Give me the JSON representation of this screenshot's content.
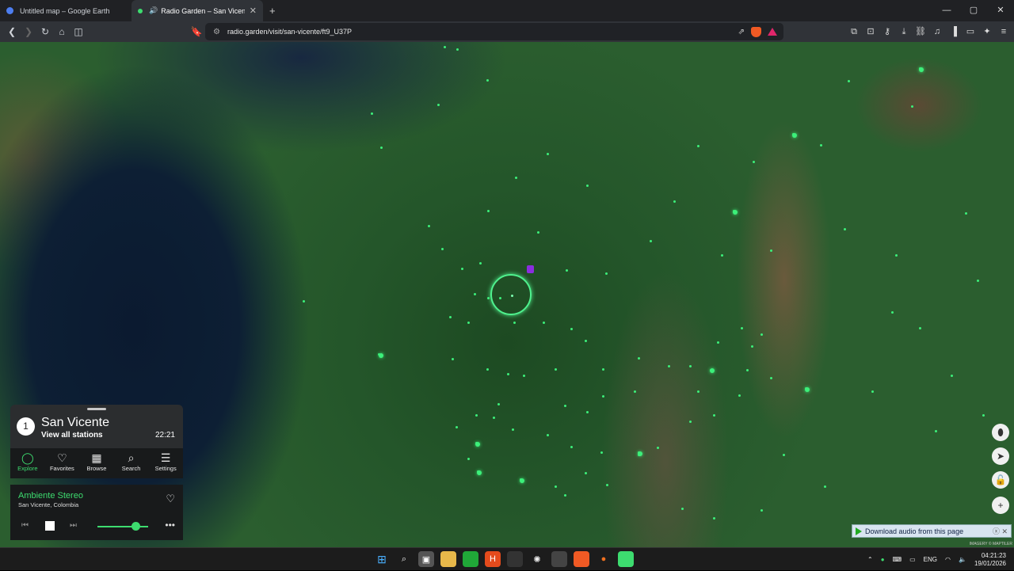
{
  "browser": {
    "tabs": [
      {
        "title": "Untitled map – Google Earth",
        "active": false,
        "icon": "google-earth-icon"
      },
      {
        "title": "Radio Garden – San Vicente",
        "active": true,
        "icon": "audio-icon"
      }
    ],
    "url": "radio.garden/visit/san-vicente/ft9_U37P"
  },
  "panel": {
    "badge": "1",
    "place": "San Vicente",
    "view_all": "View all stations",
    "time": "22:21",
    "nav": [
      {
        "label": "Explore",
        "icon": "explore-icon",
        "active": true
      },
      {
        "label": "Favorites",
        "icon": "heart-icon",
        "active": false
      },
      {
        "label": "Browse",
        "icon": "map-icon",
        "active": false
      },
      {
        "label": "Search",
        "icon": "search-icon",
        "active": false
      },
      {
        "label": "Settings",
        "icon": "menu-icon",
        "active": false
      }
    ]
  },
  "player": {
    "station": "Ambiente Stereo",
    "location": "San Vicente, Colombia",
    "volume": 0.75
  },
  "download_bar": {
    "label": "Download audio from this page"
  },
  "imagery_credit": "IMAGERY © MAPTILER",
  "taskbar": {
    "language": "ENG",
    "time": "04:21:23",
    "date": "19/01/2026"
  },
  "colors": {
    "accent": "#3ddc6f",
    "ring": "#4ff28e"
  }
}
